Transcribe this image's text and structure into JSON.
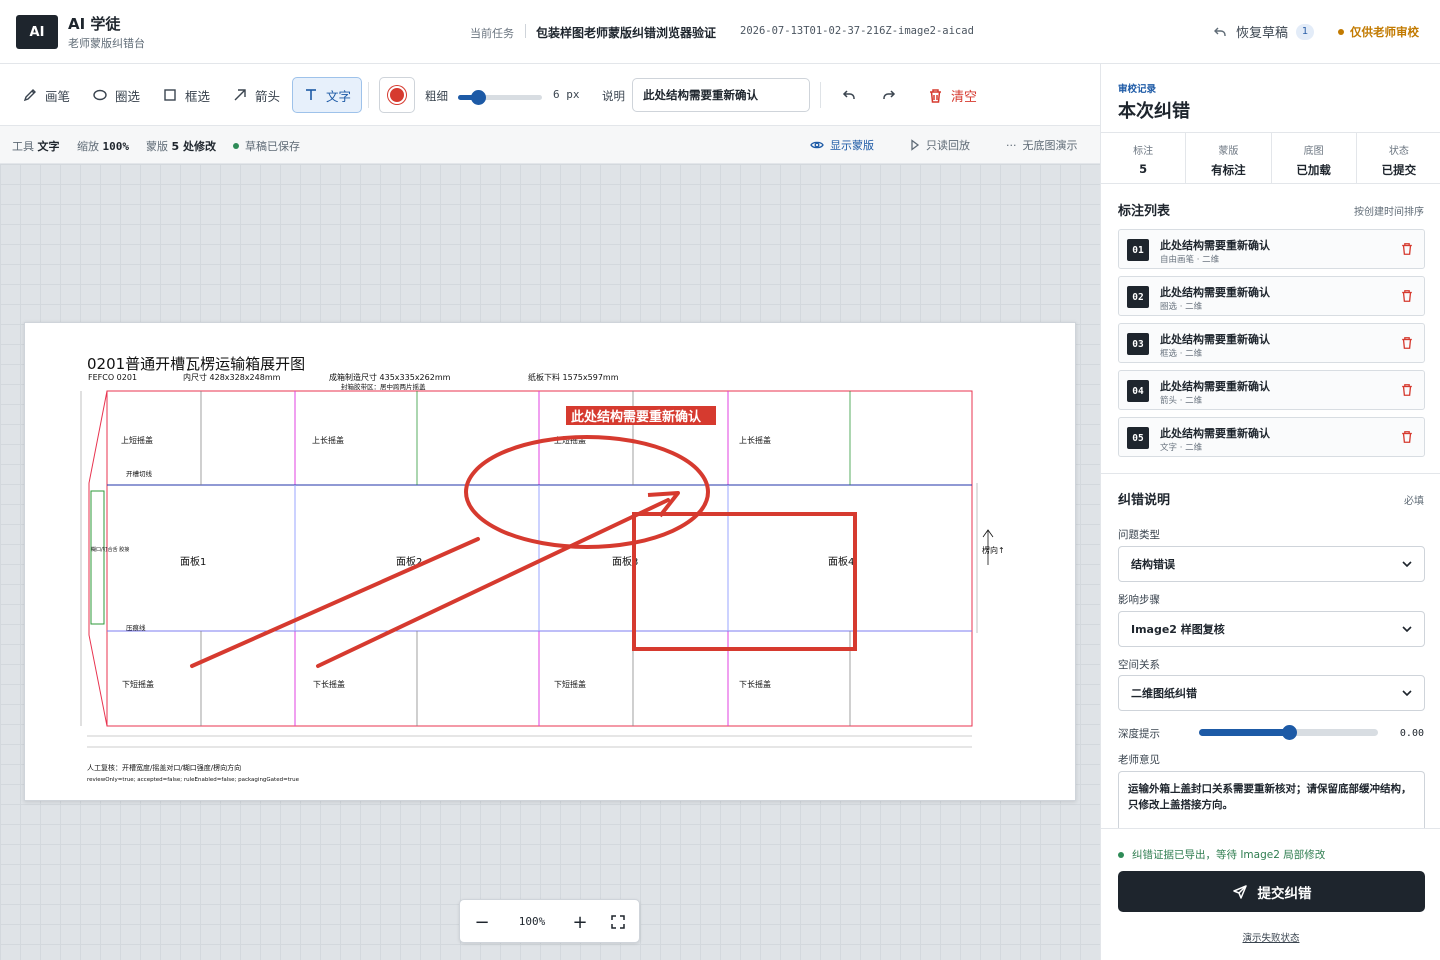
{
  "header": {
    "logo": "AI",
    "app_title": "AI 学徒",
    "app_subtitle": "老师蒙版纠错台",
    "task_label": "当前任务",
    "task_name": "包装样图老师蒙版纠错浏览器验证",
    "task_id": "2026-07-13T01-02-37-216Z-image2-aicad",
    "restore_label": "恢复草稿",
    "restore_count": "1",
    "teacher_only": "仅供老师审校"
  },
  "toolbar": {
    "tools": [
      {
        "label": "画笔",
        "icon": "pencil-icon"
      },
      {
        "label": "圈选",
        "icon": "ellipse-icon"
      },
      {
        "label": "框选",
        "icon": "rectangle-icon"
      },
      {
        "label": "箭头",
        "icon": "arrow-icon"
      },
      {
        "label": "文字",
        "icon": "text-icon",
        "active": true
      }
    ],
    "color": "#d63a2f",
    "width_label": "粗细",
    "width_value": "6 px",
    "width_fraction": 0.24,
    "desc_label": "说明",
    "desc_value": "此处结构需要重新确认",
    "clear_label": "清空"
  },
  "statusbar": {
    "tool_label": "工具",
    "tool_value": "文字",
    "zoom_label": "缩放",
    "zoom_value": "100%",
    "mask_label": "蒙版",
    "mask_value": "5 处修改",
    "saved": "草稿已保存",
    "show_mask": "显示蒙版",
    "readonly_replay": "只读回放",
    "no_base_demo": "无底图演示"
  },
  "drawing": {
    "title": "0201普通开槽瓦楞运输箱展开图",
    "fefco": "FEFCO 0201",
    "inner_size": "内尺寸 428x328x248mm",
    "make_size": "成箱制造尺寸 435x335x262mm",
    "seal_zone": "封箱胶带区：居中跨两片摇盖",
    "sheet_size": "纸板下料 1575x597mm",
    "top_flaps": [
      "上短摇盖",
      "上长摇盖",
      "上短摇盖",
      "上长摇盖"
    ],
    "bottom_flaps": [
      "下短摇盖",
      "下长摇盖",
      "下短摇盖",
      "下长摇盖"
    ],
    "panels": [
      "面板1",
      "面板2",
      "面板3",
      "面板4"
    ],
    "slot_cut": "开槽切线",
    "crease": "压痕线",
    "glue_flap": "糊口/钉合舌 胶接",
    "flute": "楞向↑",
    "review": "人工复核：开槽宽度/摇盖对口/糊口强度/楞向方向",
    "flags": "reviewOnly=true; accepted=false; ruleEnabled=false; packagingGated=true",
    "annotation_text": "此处结构需要重新确认",
    "annotation_color": "#d63a2f"
  },
  "zoombar": {
    "minus": "−",
    "value": "100%",
    "plus": "+"
  },
  "panel": {
    "kicker": "审校记录",
    "title": "本次纠错",
    "stats": [
      {
        "k": "标注",
        "v": "5"
      },
      {
        "k": "蒙版",
        "v": "有标注"
      },
      {
        "k": "底图",
        "v": "已加载"
      },
      {
        "k": "状态",
        "v": "已提交"
      }
    ],
    "list_title": "标注列表",
    "list_sort": "按创建时间排序",
    "annotations": [
      {
        "num": "01",
        "text": "此处结构需要重新确认",
        "sub": "自由画笔 · 二维"
      },
      {
        "num": "02",
        "text": "此处结构需要重新确认",
        "sub": "圈选 · 二维"
      },
      {
        "num": "03",
        "text": "此处结构需要重新确认",
        "sub": "框选 · 二维"
      },
      {
        "num": "04",
        "text": "此处结构需要重新确认",
        "sub": "箭头 · 二维"
      },
      {
        "num": "05",
        "text": "此处结构需要重新确认",
        "sub": "文字 · 二维"
      }
    ],
    "fix_title": "纠错说明",
    "fix_required": "必填",
    "issue_type_label": "问题类型",
    "issue_type": "结构错误",
    "step_label": "影响步骤",
    "step": "Image2 样图复核",
    "spatial_label": "空间关系",
    "spatial": "二维图纸纠错",
    "depth_label": "深度提示",
    "depth_value": "0.00",
    "depth_fraction": 0.5,
    "opinion_label": "老师意见",
    "opinion": "运输外箱上盖封口关系需要重新核对；请保留底部缓冲结构，只修改上盖搭接方向。",
    "evidence": "纠错证据已导出，等待 Image2 局部修改",
    "submit": "提交纠错",
    "fail_link": "演示失败状态"
  }
}
